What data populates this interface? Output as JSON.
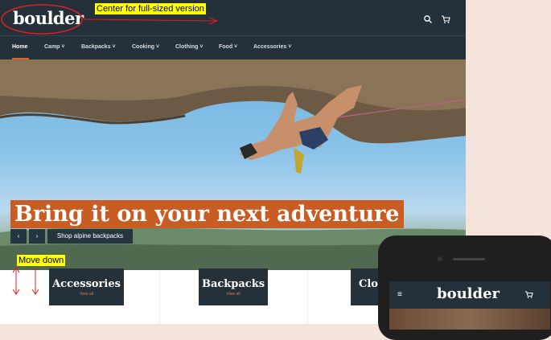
{
  "brand": {
    "name": "boulder"
  },
  "header": {
    "icons": [
      "search-icon",
      "cart-icon"
    ]
  },
  "nav": {
    "items": [
      "Home",
      "Camp",
      "Backpacks",
      "Cooking",
      "Clothing",
      "Food",
      "Accessories"
    ],
    "active": "Home"
  },
  "hero": {
    "headline": "Bring it on your next adventure",
    "prev": "‹",
    "next": "›",
    "cta": "Shop alpine backpacks"
  },
  "categories": [
    {
      "title": "Accessories",
      "link": "View all"
    },
    {
      "title": "Backpacks",
      "link": "View all"
    },
    {
      "title": "Clot",
      "link": ""
    }
  ],
  "annotations": {
    "center": "Center for full-sized version",
    "move": "Move down"
  },
  "mobile": {
    "logo": "boulder",
    "menu_icon": "≡"
  },
  "colors": {
    "header": "#24313a",
    "accent": "#c85c22",
    "annotation": "#ffff00",
    "arrow": "#e02020"
  }
}
